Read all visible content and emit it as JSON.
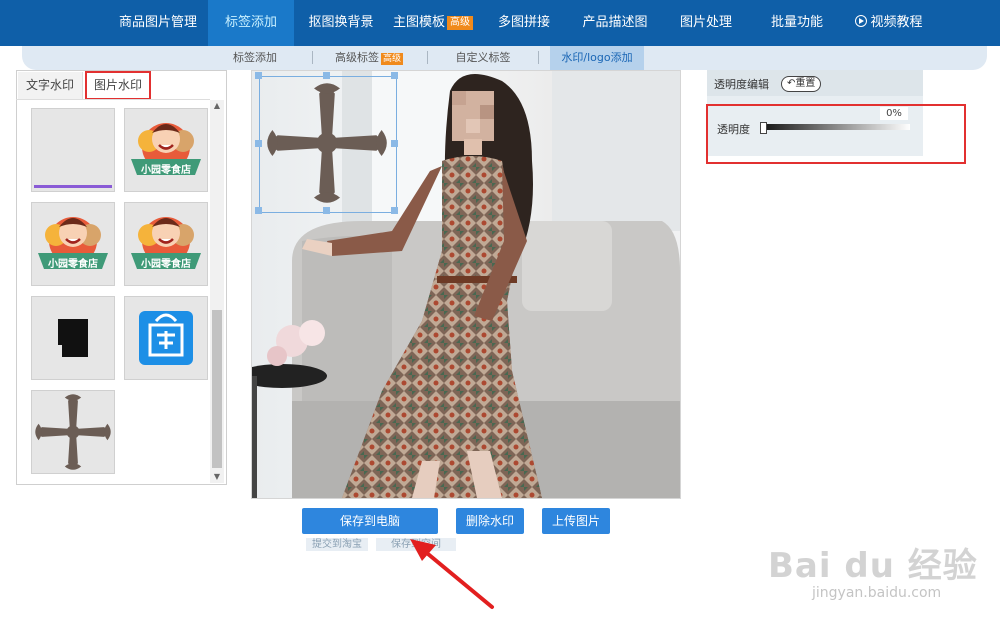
{
  "nav": {
    "items": [
      {
        "label": "商品图片管理"
      },
      {
        "label": "标签添加"
      },
      {
        "label": "抠图换背景"
      },
      {
        "label": "主图模板",
        "badge": "高级"
      },
      {
        "label": "多图拼接"
      },
      {
        "label": "产品描述图"
      },
      {
        "label": "图片处理"
      },
      {
        "label": "批量功能"
      },
      {
        "label": "视频教程"
      }
    ]
  },
  "subnav": {
    "items": [
      {
        "label": "标签添加"
      },
      {
        "label": "高级标签",
        "badge": "高级"
      },
      {
        "label": "自定义标签"
      },
      {
        "label": "水印/logo添加"
      }
    ]
  },
  "left": {
    "tabs": [
      {
        "label": "文字水印"
      },
      {
        "label": "图片水印"
      }
    ]
  },
  "right": {
    "title": "透明度编辑",
    "reset_label": "重置",
    "opacity_label": "透明度",
    "opacity_value": "0%",
    "opacity_fraction": 0
  },
  "actions": {
    "save": "保存到电脑",
    "delete": "删除水印",
    "upload": "上传图片",
    "submit_taobao": "提交到淘宝",
    "save_space": "保存到空间"
  },
  "logo_text": "小园零食店",
  "watermark": {
    "text": "Bai du 经验",
    "url": "jingyan.baidu.com"
  },
  "colors": {
    "nav": "#0f5fa8",
    "accent": "#2e86de",
    "highlight": "#e23030",
    "badge": "#f08a1c"
  }
}
